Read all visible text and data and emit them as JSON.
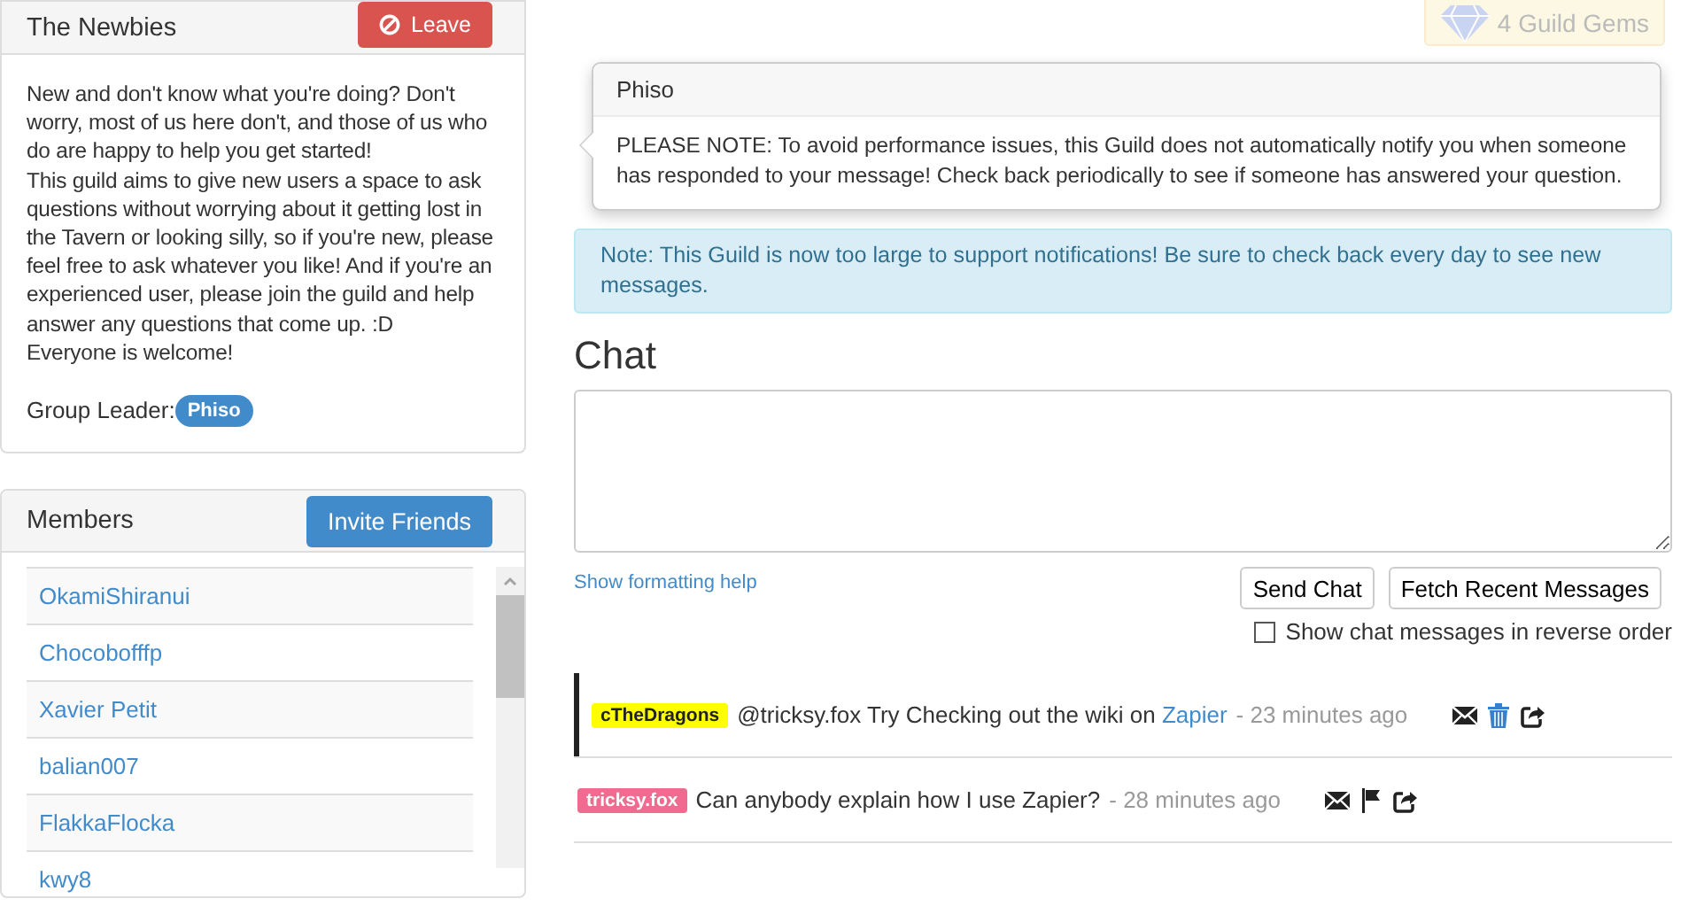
{
  "guild": {
    "title": "The Newbies",
    "leave_button": "Leave",
    "description": "New and don't know what you're doing? Don't worry, most of us here don't, and those of us who do are happy to help you get started!\nThis guild aims to give new users a space to ask questions without worrying about it getting lost in the Tavern or looking silly, so if you're new, please feel free to ask whatever you like! And if you're an experienced user, please join the guild and help answer any questions that come up. :D\nEveryone is welcome!",
    "leader_label": "Group Leader:",
    "leader": "Phiso"
  },
  "members": {
    "title": "Members",
    "invite_button": "Invite Friends",
    "items": [
      {
        "name": "OkamiShiranui"
      },
      {
        "name": "Chocobofffp"
      },
      {
        "name": "Xavier Petit"
      },
      {
        "name": "balian007"
      },
      {
        "name": "FlakkaFlocka"
      },
      {
        "name": "kwy8"
      }
    ]
  },
  "gems_button": "4 Guild Gems",
  "notice": {
    "author": "Phiso",
    "text": "PLEASE NOTE: To avoid performance issues, this Guild does not automatically notify you when someone has responded to your message! Check back periodically to see if someone has answered your question."
  },
  "alert": "Note: This Guild is now too large to support notifications! Be sure to check back every day to see new messages.",
  "chat": {
    "title": "Chat",
    "formatting_link": "Show formatting help",
    "send_button": "Send Chat",
    "fetch_button": "Fetch Recent Messages",
    "reverse_order": {
      "label": "Show chat messages in reverse order",
      "checked": false
    }
  },
  "messages": [
    {
      "user": "cTheDragons",
      "color": "#ffff00",
      "highlighted": true,
      "text": "@tricksy.fox Try Checking out the wiki on",
      "link": "Zapier",
      "time": "- 23 minutes ago",
      "actions": [
        {
          "kind": "message"
        },
        {
          "kind": "delete"
        },
        {
          "kind": "share"
        }
      ]
    },
    {
      "user": "tricksy.fox",
      "color": "#f06b8f",
      "highlighted": false,
      "text": "Can anybody explain how I use Zapier?",
      "time": "- 28 minutes ago",
      "actions": [
        {
          "kind": "message"
        },
        {
          "kind": "flag"
        },
        {
          "kind": "share"
        }
      ]
    }
  ]
}
